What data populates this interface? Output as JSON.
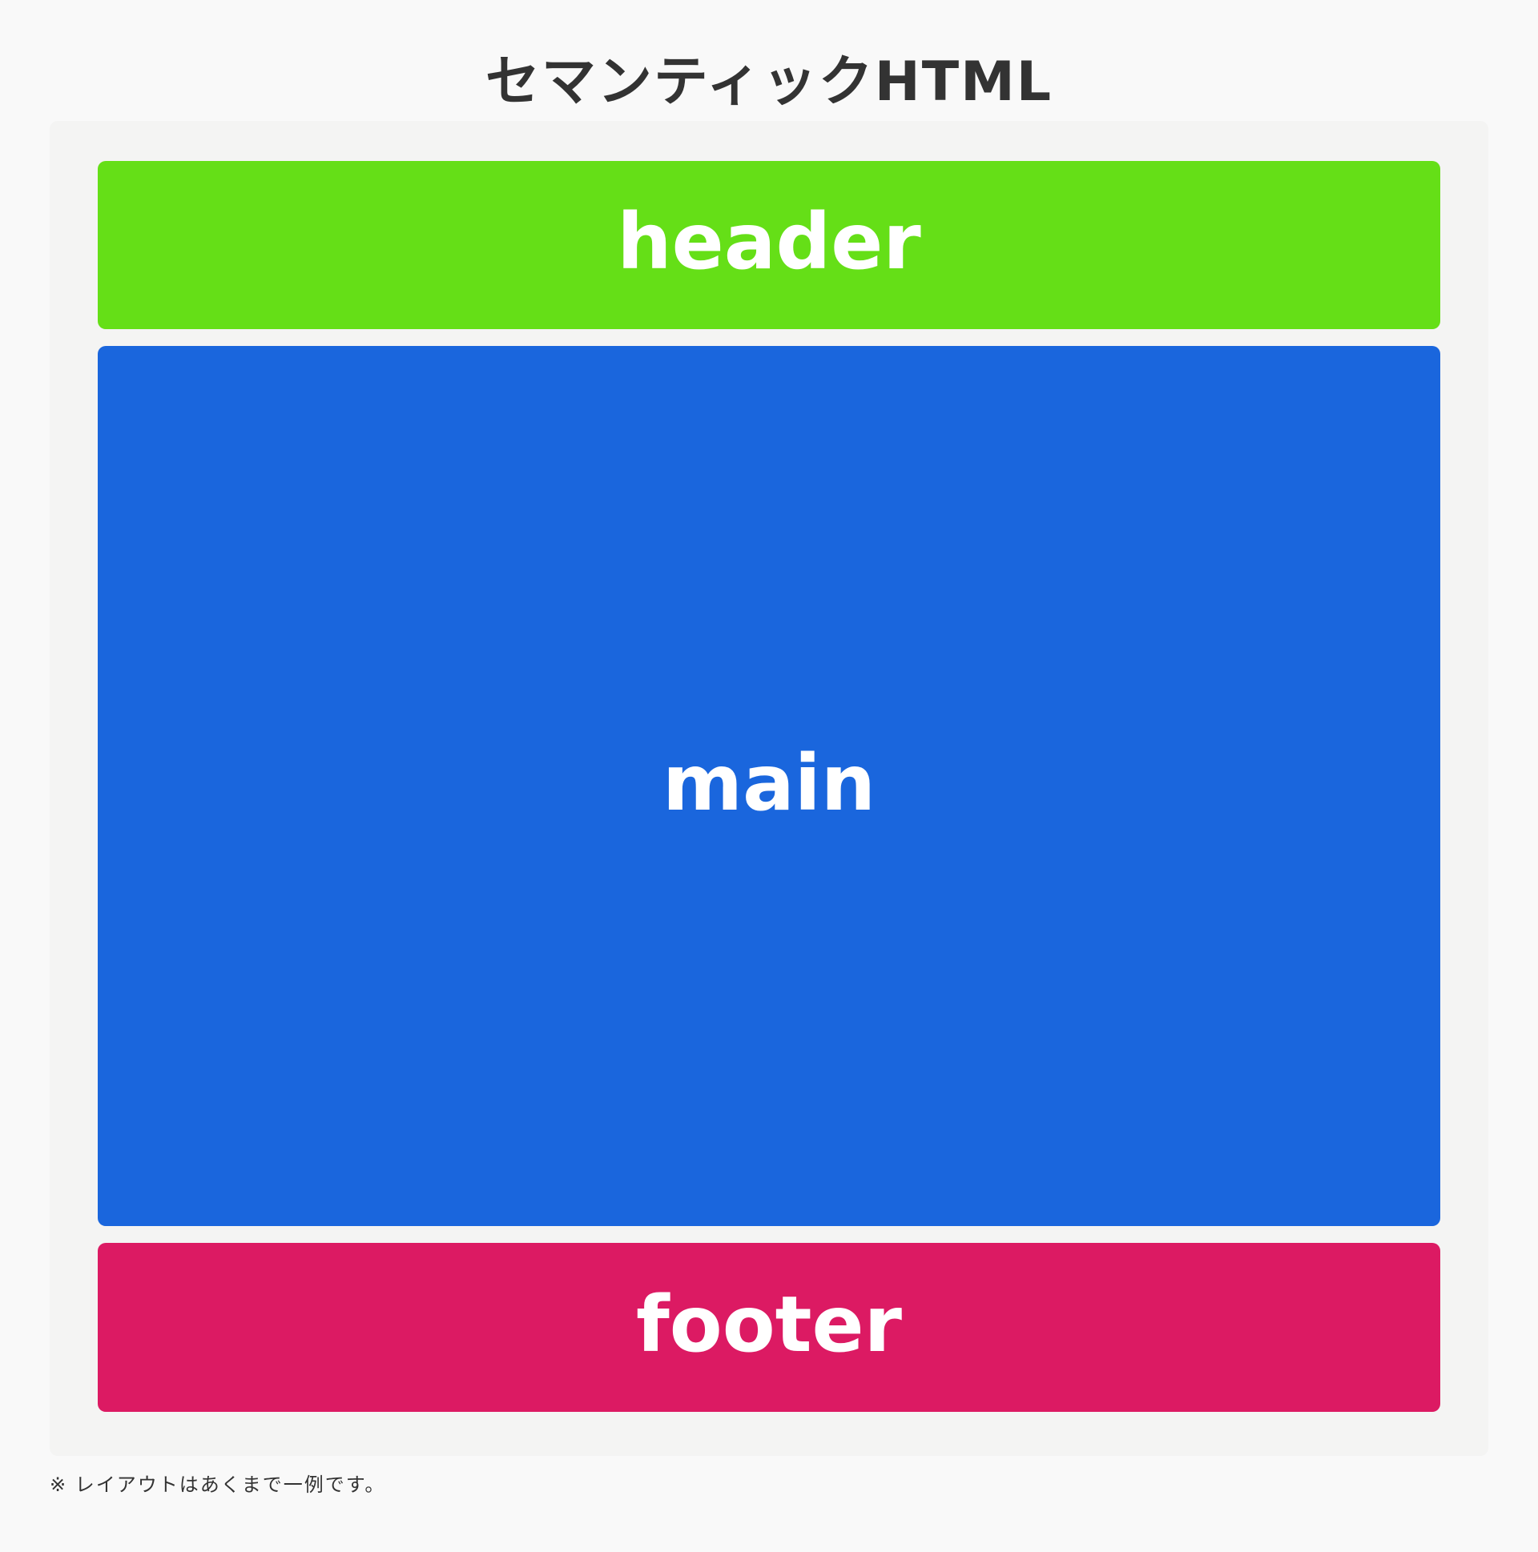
{
  "title": "セマンティックHTML",
  "blocks": [
    {
      "label": "header",
      "color": "#65df17"
    },
    {
      "label": "main",
      "color": "#1a66dd"
    },
    {
      "label": "footer",
      "color": "#dc1a63"
    }
  ],
  "note": "※ レイアウトはあくまで一例です。"
}
